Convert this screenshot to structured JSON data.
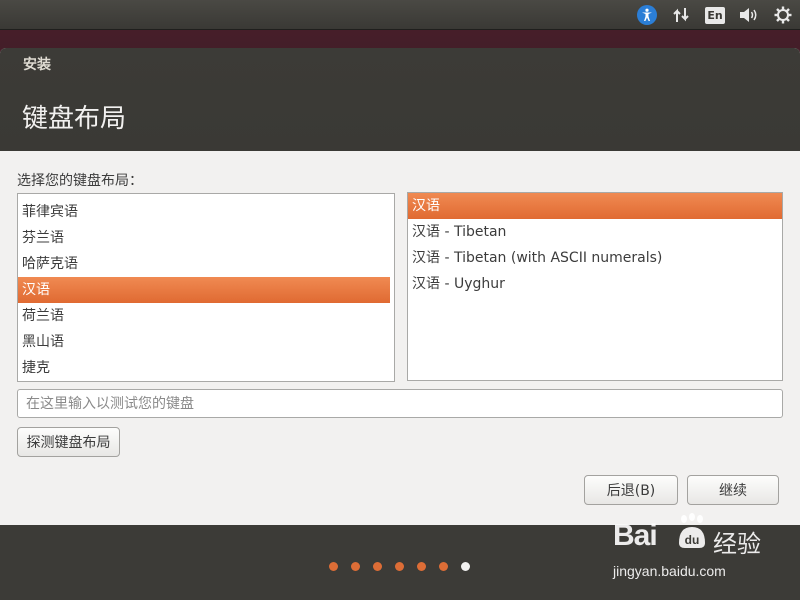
{
  "top_panel": {
    "indicators": [
      {
        "name": "accessibility-icon",
        "glyph": "✱"
      },
      {
        "name": "network-icon",
        "glyph": "⇅"
      },
      {
        "name": "keyboard-layout-indicator",
        "label": "En"
      },
      {
        "name": "volume-icon",
        "glyph": "🔊"
      },
      {
        "name": "gear-icon",
        "glyph": "⚙"
      }
    ]
  },
  "window": {
    "title": "安装",
    "page_title": "键盘布局",
    "prompt": "选择您的键盘布局：",
    "layouts": [
      {
        "label": "菲律宾语",
        "selected": false
      },
      {
        "label": "芬兰语",
        "selected": false
      },
      {
        "label": "哈萨克语",
        "selected": false
      },
      {
        "label": "汉语",
        "selected": true
      },
      {
        "label": "荷兰语",
        "selected": false
      },
      {
        "label": "黑山语",
        "selected": false
      },
      {
        "label": "捷克",
        "selected": false
      }
    ],
    "variants": [
      {
        "label": "汉语",
        "selected": true
      },
      {
        "label": "汉语 - Tibetan",
        "selected": false
      },
      {
        "label": "汉语 - Tibetan (with ASCII numerals)",
        "selected": false
      },
      {
        "label": "汉语 - Uyghur",
        "selected": false
      }
    ],
    "test_input": {
      "value": "",
      "placeholder": "在这里输入以测试您的键盘"
    },
    "detect_button": "探测键盘布局",
    "back_button": "后退(B)",
    "continue_button": "继续",
    "progress": {
      "total_steps": 7,
      "current_step": 7
    }
  },
  "watermark": {
    "logo": "Bai",
    "logo_suffix": "du",
    "jingyan": "经验",
    "url": "jingyan.baidu.com"
  },
  "colors": {
    "accent": "#dd4814",
    "selection": "#e8753e",
    "header": "#3c3b37"
  }
}
